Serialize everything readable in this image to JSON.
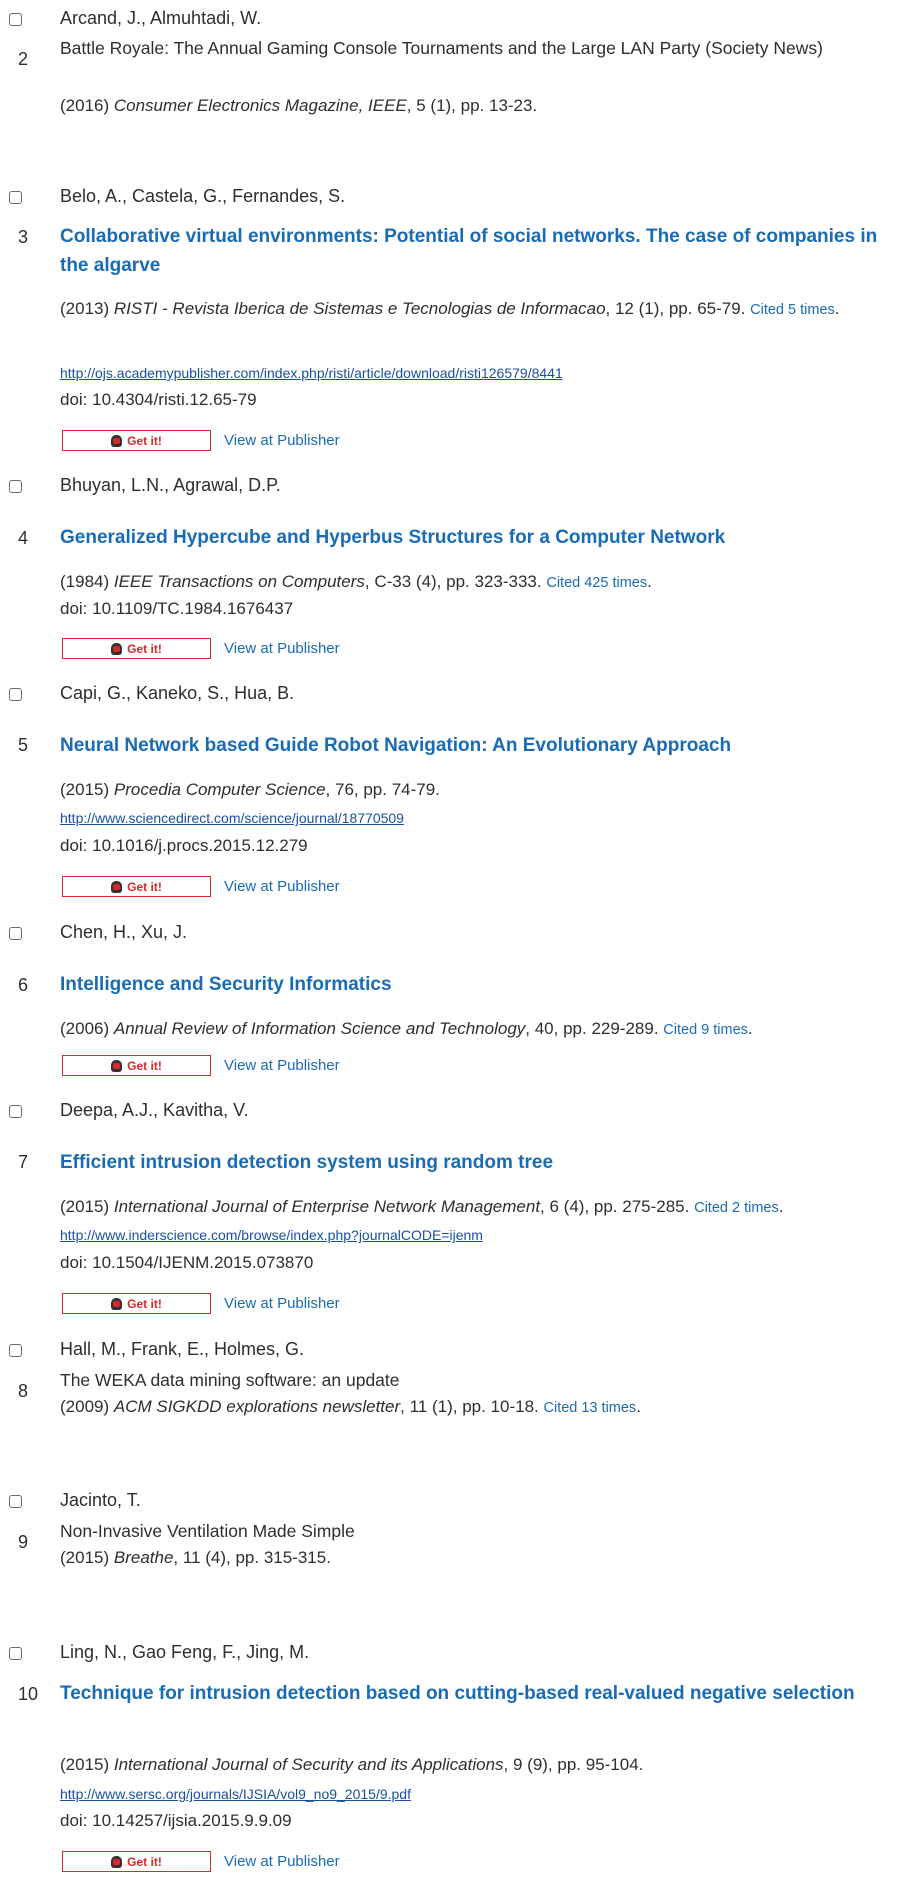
{
  "get_it_label": "Get it!",
  "view_label": "View at Publisher",
  "refs": [
    {
      "number": "2",
      "authors": "Arcand, J., Almuhtadi, W.",
      "title": "Battle Royale: The Annual Gaming Console Tournaments and the Large LAN Party (Society News)",
      "year": "(2016)",
      "journal": "Consumer Electronics Magazine, IEEE",
      "details": ", 5 (1), pp. 13-23."
    },
    {
      "number": "3",
      "authors": "Belo, A., Castela, G., Fernandes, S.",
      "title": "Collaborative virtual environments: Potential of social networks. The case of companies in the algarve",
      "year": "(2013)",
      "journal": "RISTI - Revista Iberica de Sistemas e Tecnologias de Informacao",
      "details": ", 12 (1), pp. 65-79.",
      "cited": "Cited 5 times",
      "url": "http://ojs.academypublisher.com/index.php/risti/article/download/risti126579/8441",
      "doi": "doi: 10.4304/risti.12.65-79"
    },
    {
      "number": "4",
      "authors": "Bhuyan, L.N., Agrawal, D.P.",
      "title": "Generalized Hypercube and Hyperbus Structures for a Computer Network",
      "year": "(1984)",
      "journal": "IEEE Transactions on Computers",
      "details": ", C-33 (4), pp. 323-333.",
      "cited": "Cited 425 times",
      "doi": "doi: 10.1109/TC.1984.1676437"
    },
    {
      "number": "5",
      "authors": "Capi, G., Kaneko, S., Hua, B.",
      "title": "Neural Network based Guide Robot Navigation: An Evolutionary Approach",
      "year": "(2015)",
      "journal": "Procedia Computer Science",
      "details": ", 76, pp. 74-79.",
      "url": "http://www.sciencedirect.com/science/journal/18770509",
      "doi": "doi: 10.1016/j.procs.2015.12.279"
    },
    {
      "number": "6",
      "authors": "Chen, H., Xu, J.",
      "title": "Intelligence and Security Informatics",
      "year": "(2006)",
      "journal": "Annual Review of Information Science and Technology",
      "details": ", 40, pp. 229-289.",
      "cited": "Cited 9 times"
    },
    {
      "number": "7",
      "authors": "Deepa, A.J., Kavitha, V.",
      "title": "Efficient intrusion detection system using random tree",
      "year": "(2015)",
      "journal": "International Journal of Enterprise Network Management",
      "details": ", 6 (4), pp. 275-285.",
      "cited": "Cited 2 times",
      "url": "http://www.inderscience.com/browse/index.php?journalCODE=ijenm",
      "doi": "doi: 10.1504/IJENM.2015.073870"
    },
    {
      "number": "8",
      "authors": "Hall, M., Frank, E., Holmes, G.",
      "title": "The WEKA data mining software: an update",
      "year": "(2009)",
      "journal": "ACM SIGKDD explorations newsletter",
      "details": ", 11 (1), pp. 10-18.",
      "cited": "Cited 13 times"
    },
    {
      "number": "9",
      "authors": "Jacinto, T.",
      "title": "Non-Invasive Ventilation Made Simple",
      "year": "(2015)",
      "journal": "Breathe",
      "details": ", 11 (4), pp. 315-315."
    },
    {
      "number": "10",
      "authors": "Ling, N., Gao Feng, F., Jing, M.",
      "title": "Technique for intrusion detection based on cutting-based real-valued negative selection",
      "year": "(2015)",
      "journal": "International Journal of Security and its Applications",
      "details": ", 9 (9), pp. 95-104.",
      "url": "http://www.sersc.org/journals/IJSIA/vol9_no9_2015/9.pdf",
      "doi": "doi: 10.14257/ijsia.2015.9.9.09"
    }
  ]
}
